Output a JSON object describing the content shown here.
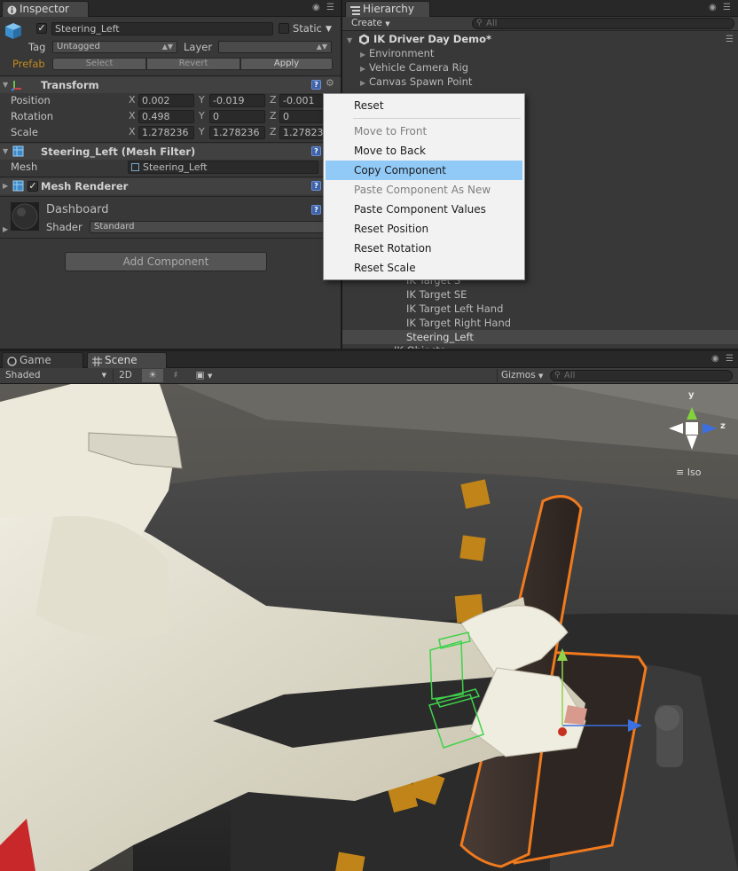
{
  "inspector": {
    "tab_label": "Inspector",
    "object_name": "Steering_Left",
    "static_label": "Static",
    "tag_label": "Tag",
    "tag_value": "Untagged",
    "layer_label": "Layer",
    "layer_value": "",
    "prefab_label": "Prefab",
    "prefab_select": "Select",
    "prefab_revert": "Revert",
    "prefab_apply": "Apply",
    "transform": {
      "title": "Transform",
      "position_label": "Position",
      "rotation_label": "Rotation",
      "scale_label": "Scale",
      "axis_x": "X",
      "axis_y": "Y",
      "axis_z": "Z",
      "position": {
        "x": "0.002",
        "y": "-0.019",
        "z": "-0.001"
      },
      "rotation": {
        "x": "0.498",
        "y": "0",
        "z": "0"
      },
      "scale": {
        "x": "1.278236",
        "y": "1.278236",
        "z": "1.27823"
      }
    },
    "mesh_filter": {
      "title": "Steering_Left (Mesh Filter)",
      "mesh_label": "Mesh",
      "mesh_value": "Steering_Left"
    },
    "mesh_renderer": {
      "title": "Mesh Renderer"
    },
    "material": {
      "name": "Dashboard",
      "shader_label": "Shader",
      "shader_value": "Standard"
    },
    "add_component": "Add Component"
  },
  "hierarchy": {
    "tab_label": "Hierarchy",
    "create_label": "Create",
    "search_placeholder": "All",
    "scene_name": "IK Driver Day Demo*",
    "items": [
      "Environment",
      "Vehicle Camera Rig",
      "Canvas Spawn Point"
    ],
    "items_lower": [
      "IK Target S",
      "IK Target SE",
      "IK Target Left Hand",
      "IK Target Right Hand"
    ],
    "selected_item": "Steering_Left",
    "partial_item": "IK Objects"
  },
  "context_menu": {
    "items": [
      {
        "label": "Reset",
        "enabled": true,
        "selected": false
      },
      {
        "label": "Move to Front",
        "enabled": false,
        "selected": false
      },
      {
        "label": "Move to Back",
        "enabled": true,
        "selected": false
      },
      {
        "label": "Copy Component",
        "enabled": true,
        "selected": true
      },
      {
        "label": "Paste Component As New",
        "enabled": false,
        "selected": false
      },
      {
        "label": "Paste Component Values",
        "enabled": true,
        "selected": false
      },
      {
        "label": "Reset Position",
        "enabled": true,
        "selected": false
      },
      {
        "label": "Reset Rotation",
        "enabled": true,
        "selected": false
      },
      {
        "label": "Reset Scale",
        "enabled": true,
        "selected": false
      }
    ],
    "highlight_color": "#91c9f7"
  },
  "scene": {
    "tab_game": "Game",
    "tab_scene": "Scene",
    "shading_mode": "Shaded",
    "mode_2d": "2D",
    "gizmos_label": "Gizmos",
    "search_placeholder": "All",
    "gizmo": {
      "y_label": "y",
      "z_label": "z",
      "projection": "Iso"
    },
    "selection_outline_color": "#f07a1e"
  },
  "colors": {
    "panel_bg": "#383838",
    "prefab_label": "#c28a1e",
    "selection_bg": "#484848"
  }
}
